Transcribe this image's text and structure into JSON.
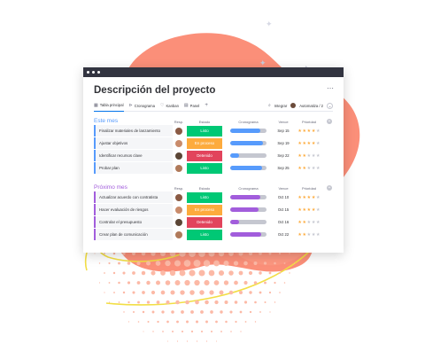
{
  "colors": {
    "blob": "#fb8f79",
    "blob_highlight": "#fd9d86",
    "swirl": "#f2de45",
    "dots": "#fcb9a6",
    "accent_blue": "#579bfc",
    "accent_purple": "#a25ddc",
    "status_done": "#00c875",
    "status_working": "#fdab3d",
    "status_stuck": "#e2445c",
    "star": "#fdab3d"
  },
  "window": {
    "title": "Descripción del proyecto",
    "more_icon": "⋯"
  },
  "toolbar": {
    "tabs": [
      {
        "label": "Tabla principal",
        "icon": "table-icon",
        "glyph": "▦"
      },
      {
        "label": "Cronograma",
        "icon": "timeline-icon",
        "glyph": "⊳"
      },
      {
        "label": "Kanban",
        "icon": "kanban-icon",
        "glyph": "♡"
      },
      {
        "label": "Panel",
        "icon": "dashboard-icon",
        "glyph": "▤"
      }
    ],
    "add_view": "+",
    "search_icon": "⌕",
    "integrate_label": "Integrar",
    "automations_label": "Automatiza / 2",
    "collapse_icon": "⌄"
  },
  "columns": {
    "responsible": "Resp.",
    "status": "Estado",
    "timeline": "Cronograma",
    "due": "Vence",
    "priority": "Prioridad",
    "add": "+"
  },
  "groups": [
    {
      "title": "Este mes",
      "rows": [
        {
          "name": "Finalizar materiales de lanzamiento",
          "status": "Listo",
          "due": "Sep 15",
          "timeline": 0.82,
          "stars": 4
        },
        {
          "name": "Ajustar objetivos",
          "status": "En proceso",
          "due": "Sep 19",
          "timeline": 0.9,
          "stars": 4
        },
        {
          "name": "Identificar recursos clave",
          "status": "Detenido",
          "due": "Sep 22",
          "timeline": 0.25,
          "stars": 2
        },
        {
          "name": "Probar plan",
          "status": "Listo",
          "due": "Sep 25",
          "timeline": 0.88,
          "stars": 2
        }
      ]
    },
    {
      "title": "Próximo mes",
      "rows": [
        {
          "name": "Actualizar acuerdo con contratista",
          "status": "Listo",
          "due": "Oct 10",
          "timeline": 0.82,
          "stars": 4
        },
        {
          "name": "Hacer evaluación de riesgos",
          "status": "En proceso",
          "due": "Oct 15",
          "timeline": 0.78,
          "stars": 4
        },
        {
          "name": "Controlar el presupuesto",
          "status": "Detenido",
          "due": "Oct 16",
          "timeline": 0.25,
          "stars": 2
        },
        {
          "name": "Crear plan de comunicación",
          "status": "Listo",
          "due": "Oct 22",
          "timeline": 0.85,
          "stars": 2
        }
      ]
    }
  ]
}
